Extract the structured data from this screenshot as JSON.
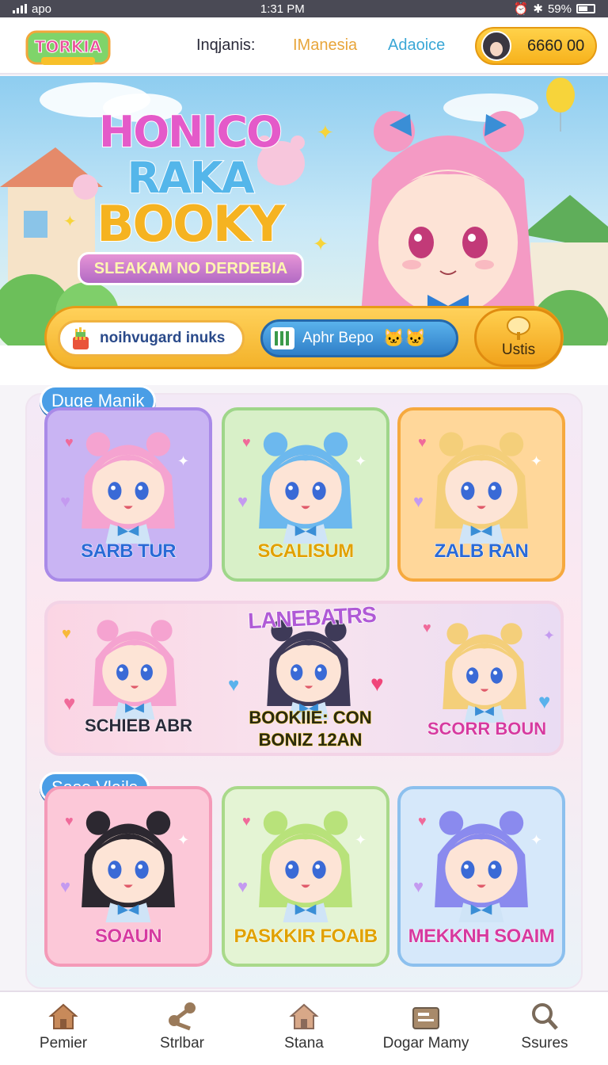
{
  "status_bar": {
    "carrier": "apo",
    "time": "1:31 PM",
    "battery": "59%"
  },
  "header": {
    "logo_text_top": "TORKIA",
    "nav_links": [
      {
        "label": "Inqjanis:",
        "color": "#2a2a3a"
      },
      {
        "label": "IManesia",
        "color": "#e8a53a"
      },
      {
        "label": "Adaoice",
        "color": "#3aa7d6"
      }
    ],
    "coins": "6660 00"
  },
  "hero": {
    "title_lines": [
      "HONICO",
      "RAKA",
      "BOOKY"
    ],
    "subtitle": "SLEAKAM NO DERDEBIA"
  },
  "search": {
    "value": "noihvugard inuks",
    "apbutton_label": "Aphr Bepo",
    "action_label": "Ustis"
  },
  "sections": [
    {
      "tag": "Duge Manik"
    },
    {
      "tag": "Sase Vlails"
    }
  ],
  "row1": [
    {
      "name": "SARB TUR",
      "hair": "#f5a3d0",
      "bg": "#c9b4f3",
      "border": "#a98ae8",
      "label": "#2a6ad6"
    },
    {
      "name": "SCALISUM",
      "hair": "#6cb8ee",
      "bg": "#d8f0c8",
      "border": "#9fd68a",
      "label": "#e0a200"
    },
    {
      "name": "ZALB RAN",
      "hair": "#f4cf7a",
      "bg": "#ffd79a",
      "border": "#f6a93e",
      "label": "#2a6ad6"
    }
  ],
  "featured": {
    "banner": "LANEBATRS",
    "items": [
      {
        "name": "SCHIEB ABR",
        "hair": "#f5a3d0",
        "label": "#2a2a3a"
      },
      {
        "name": "BOOKIIE: CON BONIZ 12AN",
        "hair": "#3e3a58",
        "label": "#2a2a10"
      },
      {
        "name": "SCORR BOUN",
        "hair": "#f4cf7a",
        "label": "#d63aa0"
      }
    ]
  },
  "row3": [
    {
      "name": "SOAUN",
      "hair": "#2c2830",
      "bg": "#fcc8d8",
      "border": "#f49ab8",
      "label": "#d63aa0"
    },
    {
      "name": "PASKKIR FOAIB",
      "hair": "#b8e27a",
      "bg": "#e4f4d4",
      "border": "#a9d98a",
      "label": "#e0a200"
    },
    {
      "name": "MEKKNH SOAIM",
      "hair": "#8a8aee",
      "bg": "#d6e8fa",
      "border": "#8cc0ee",
      "label": "#d63aa0"
    }
  ],
  "tabbar": [
    {
      "label": "Pemier",
      "icon": "home-icon"
    },
    {
      "label": "Strlbar",
      "icon": "share-icon"
    },
    {
      "label": "Stana",
      "icon": "house-icon"
    },
    {
      "label": "Dogar Mamy",
      "icon": "wallet-icon"
    },
    {
      "label": "Ssures",
      "icon": "search-icon"
    }
  ]
}
